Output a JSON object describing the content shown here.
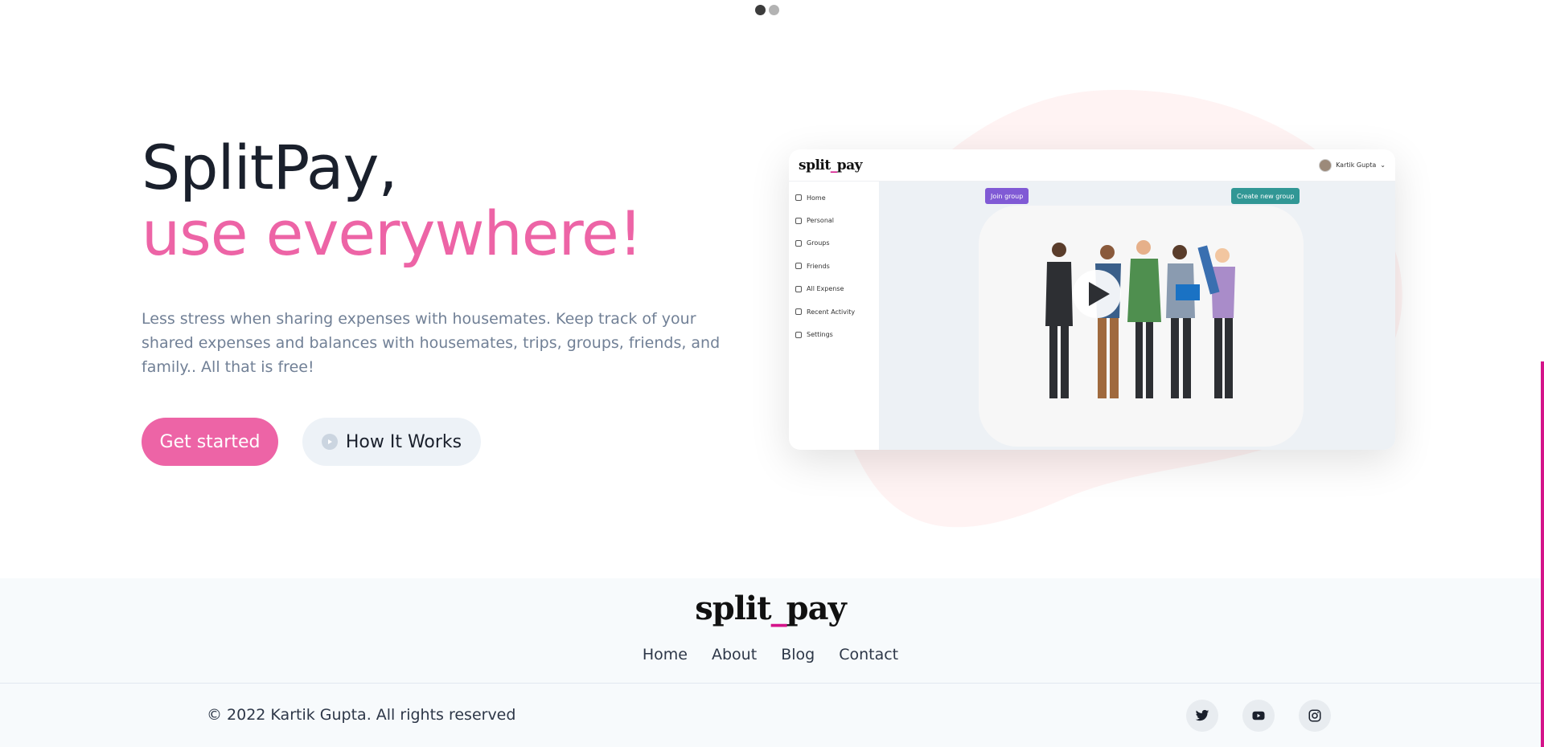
{
  "carousel": {
    "dots": [
      "active",
      "inactive"
    ]
  },
  "hero": {
    "title_line1": "SplitPay,",
    "title_line2": "use everywhere!",
    "description": "Less stress when sharing expenses with housemates. Keep track of your shared expenses and balances with housemates, trips, groups, friends, and family.. All that is free!",
    "primary_button": "Get started",
    "secondary_button": "How It Works"
  },
  "preview": {
    "logo_left": "split",
    "logo_sep": "_",
    "logo_right": "pay",
    "user_name": "Kartik Gupta",
    "nav": [
      "Home",
      "Personal",
      "Groups",
      "Friends",
      "All Expense",
      "Recent Activity",
      "Settings"
    ],
    "join_button": "Join group",
    "create_button": "Create new group"
  },
  "footer": {
    "logo_left": "split",
    "logo_sep": "_",
    "logo_right": "pay",
    "links": [
      "Home",
      "About",
      "Blog",
      "Contact"
    ],
    "copyright": "© 2022 Kartik Gupta. All rights reserved",
    "social_icons": [
      "twitter-icon",
      "youtube-icon",
      "instagram-icon"
    ]
  },
  "colors": {
    "brand_pink": "#ed64a6",
    "accent_magenta": "#d4148a",
    "join_purple": "#805ad5",
    "create_teal": "#319795"
  }
}
